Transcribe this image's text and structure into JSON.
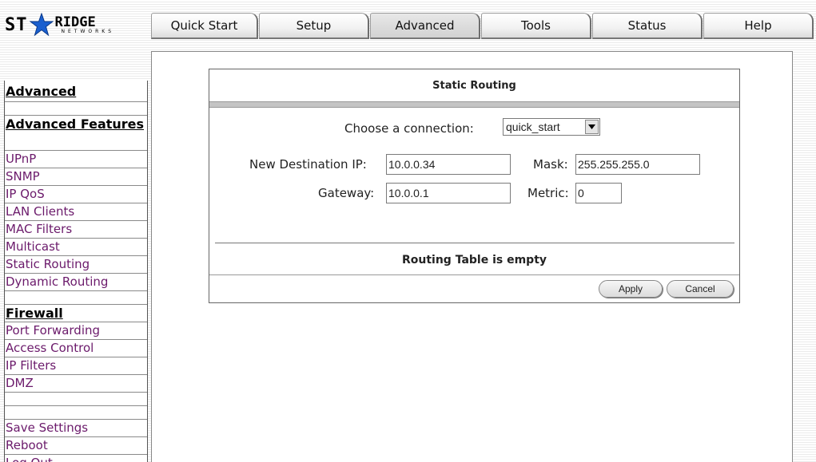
{
  "logo": {
    "left_text": "ST",
    "right_text": "RIDGE",
    "sub_text": "NETWORKS"
  },
  "tabs": [
    {
      "label": "Quick Start"
    },
    {
      "label": "Setup"
    },
    {
      "label": "Advanced"
    },
    {
      "label": "Tools"
    },
    {
      "label": "Status"
    },
    {
      "label": "Help"
    }
  ],
  "sidebar": {
    "title": "Advanced",
    "section_features": "Advanced Features",
    "features": [
      "UPnP",
      "SNMP",
      "IP QoS",
      "LAN Clients",
      "MAC Filters",
      "Multicast",
      "Static Routing",
      "Dynamic Routing"
    ],
    "section_firewall": "Firewall",
    "firewall": [
      "Port Forwarding",
      "Access Control",
      "IP Filters",
      "DMZ"
    ],
    "actions": [
      "Save Settings",
      "Reboot",
      "Log Out"
    ]
  },
  "panel": {
    "title": "Static Routing",
    "choose_label": "Choose a connection:",
    "connection_value": "quick_start",
    "dest_ip_label": "New Destination IP:",
    "dest_ip_value": "10.0.0.34",
    "mask_label": "Mask:",
    "mask_value": "255.255.255.0",
    "gateway_label": "Gateway:",
    "gateway_value": "10.0.0.1",
    "metric_label": "Metric:",
    "metric_value": "0",
    "table_message": "Routing Table is empty",
    "apply_label": "Apply",
    "cancel_label": "Cancel"
  },
  "colors": {
    "link": "#6b1a6b",
    "accent_star": "#1a5fcf"
  }
}
